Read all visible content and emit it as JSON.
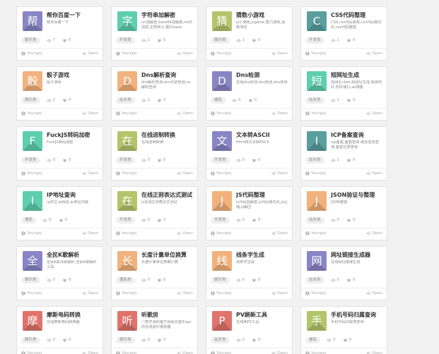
{
  "open_label": "Open",
  "colors": {
    "purple": "#8a85c5",
    "green": "#5fceac",
    "olive": "#b3c56b",
    "teal": "#5a9e9e",
    "orange": "#f2b27d",
    "red": "#e0736b"
  },
  "cards": [
    {
      "char": "帮",
      "color": "#8a85c5",
      "title": "帮你百度一下",
      "desc": "帮你百度一下",
      "category": "娱乐类",
      "views": "7",
      "likes": "0",
      "author": "Youngxj"
    },
    {
      "char": "字",
      "color": "#5fceac",
      "title": "字符串加解密",
      "desc": "url加解密,base64加解密,md5加密,正则转义,图片base",
      "category": "开发类",
      "views": "2",
      "likes": "0",
      "author": "Youngxj"
    },
    {
      "char": "猜",
      "color": "#b3c56b",
      "title": "猜数小游戏",
      "desc": "js小游戏,jsgame,智力游戏,猜数测试",
      "category": "娱乐类",
      "views": "1",
      "likes": "0",
      "author": "Youngxj"
    },
    {
      "char": "C",
      "color": "#5a9e9e",
      "title": "CSS代码整理",
      "desc": "CSS,css代码高亮,css代码格式化,css代码整理",
      "category": "开发类",
      "views": "1",
      "likes": "0",
      "author": "Youngxj"
    },
    {
      "char": "骰",
      "color": "#f2b27d",
      "title": "骰子游戏",
      "desc": "骰子游戏",
      "category": "娱乐类",
      "views": "2",
      "likes": "0",
      "author": "Youngxj"
    },
    {
      "char": "D",
      "color": "#f2b27d",
      "title": "Dns解析查询",
      "desc": "dns解析查询,dns记录查询,ns解析查询",
      "category": "站长类",
      "views": "2",
      "likes": "0",
      "author": "Youngxj"
    },
    {
      "char": "D",
      "color": "#8a85c5",
      "title": "Dns检测",
      "desc": "在线dns检测,dns检测,dns劫持",
      "category": "便民",
      "views": "0",
      "likes": "0",
      "author": "Youngxj"
    },
    {
      "char": "短",
      "color": "#5fceac",
      "title": "短网址生成",
      "desc": "短网址,dwz,短网址生成,免费防红,防红接口,ae博客",
      "category": "站长类",
      "views": "1",
      "likes": "0",
      "author": "Youngxj"
    },
    {
      "char": "F",
      "color": "#5fceac",
      "title": "FuckJS转码加密",
      "desc": "FuckJS转码加密",
      "category": "开发类",
      "views": "0",
      "likes": "0",
      "author": "Youngxj"
    },
    {
      "char": "在",
      "color": "#b3c56b",
      "title": "在线进制转换",
      "desc": "在线进制转换",
      "category": "开发类",
      "views": "0",
      "likes": "0",
      "author": "Youngxj"
    },
    {
      "char": "文",
      "color": "#8a85c5",
      "title": "文本转ASCII",
      "desc": "Html转文本转ASCII",
      "category": "开发类",
      "views": "0",
      "likes": "0",
      "author": "Youngxj"
    },
    {
      "char": "I",
      "color": "#5a9e9e",
      "title": "ICP备案查询",
      "desc": "icp备案,备案查询,域名信息查询,备案记录查询",
      "category": "站长类",
      "views": "1",
      "likes": "0",
      "author": "Youngxj"
    },
    {
      "char": "I",
      "color": "#5fceac",
      "title": "IP地址查询",
      "desc": "ip定位,ip相关,ip地址归属",
      "category": "便民",
      "views": "0",
      "likes": "0",
      "author": "Youngxj"
    },
    {
      "char": "在",
      "color": "#b3c56b",
      "title": "在线正则表达式测试",
      "desc": "js在线正则表达式测试",
      "category": "开发类",
      "views": "0",
      "likes": "0",
      "author": "Youngxj"
    },
    {
      "char": "J",
      "color": "#f2b27d",
      "title": "JS代码整理",
      "desc": "Js代码加解密,js代码格式化,js压缩,js解压",
      "category": "开发类",
      "views": "0",
      "likes": "0",
      "author": "Youngxj"
    },
    {
      "char": "J",
      "color": "#f2b27d",
      "title": "JSON验证与整理",
      "desc": "JSON整理",
      "category": "站长类",
      "views": "0",
      "likes": "0",
      "author": "Youngxj"
    },
    {
      "char": "全",
      "color": "#8a85c5",
      "title": "全民K歌解析",
      "desc": "全民K歌,K歌解析,全民K歌解析工具",
      "category": "娱乐类",
      "views": "0",
      "likes": "0",
      "author": "Youngxj"
    },
    {
      "char": "长",
      "color": "#f2b27d",
      "title": "长度计量单位换算",
      "desc": "长度计量单位换算计算",
      "category": "便民类",
      "views": "0",
      "likes": "0",
      "author": "Youngxj"
    },
    {
      "char": "线",
      "color": "#f2b27d",
      "title": "线条字生成",
      "desc": "线条字生成",
      "category": "娱乐类",
      "views": "0",
      "likes": "0",
      "author": "Youngxj"
    },
    {
      "char": "网",
      "color": "#8a85c5",
      "title": "网址链接生成器",
      "desc": "在线网址链接生成",
      "category": "站长类",
      "views": "0",
      "likes": "0",
      "author": "Youngxj"
    },
    {
      "char": "摩",
      "color": "#e0736b",
      "title": "摩斯电码转换",
      "desc": "在线摩斯电码转换器",
      "category": "娱乐类",
      "views": "0",
      "likes": "0",
      "author": "Youngxj"
    },
    {
      "char": "听",
      "color": "#e0736b",
      "title": "听歌房",
      "desc": "一款开源的基于网易云音乐api的在线音乐播放器",
      "category": "娱乐类",
      "views": "0",
      "likes": "0",
      "author": "Youngxj"
    },
    {
      "char": "P",
      "color": "#e0736b",
      "title": "PV刷新工具",
      "desc": "在线刷PV工具",
      "category": "站长类",
      "views": "2",
      "likes": "0",
      "author": "Youngxj"
    },
    {
      "char": "手",
      "color": "#b3c56b",
      "title": "手机号码归属查询",
      "desc": "手机号码归属地查询",
      "category": "便民",
      "views": "0",
      "likes": "0",
      "author": "Youngxj"
    }
  ]
}
